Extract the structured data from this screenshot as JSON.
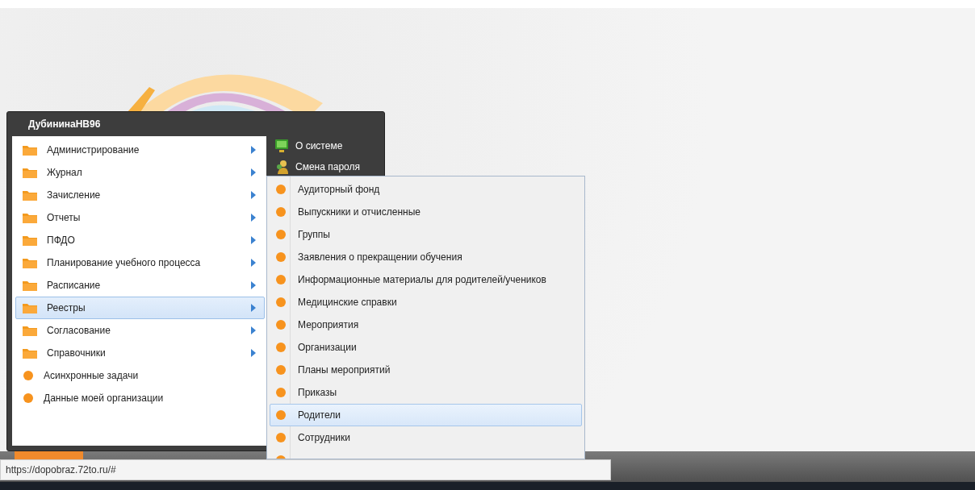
{
  "user": "ДубининаНВ96",
  "menu_items": [
    {
      "label": "Администрирование",
      "kind": "folder",
      "has_submenu": true,
      "selected": false
    },
    {
      "label": "Журнал",
      "kind": "folder",
      "has_submenu": true,
      "selected": false
    },
    {
      "label": "Зачисление",
      "kind": "folder",
      "has_submenu": true,
      "selected": false
    },
    {
      "label": "Отчеты",
      "kind": "folder",
      "has_submenu": true,
      "selected": false
    },
    {
      "label": "ПФДО",
      "kind": "folder",
      "has_submenu": true,
      "selected": false
    },
    {
      "label": "Планирование учебного процесса",
      "kind": "folder",
      "has_submenu": true,
      "selected": false
    },
    {
      "label": "Расписание",
      "kind": "folder",
      "has_submenu": true,
      "selected": false
    },
    {
      "label": "Реестры",
      "kind": "folder",
      "has_submenu": true,
      "selected": true
    },
    {
      "label": "Согласование",
      "kind": "folder",
      "has_submenu": true,
      "selected": false
    },
    {
      "label": "Справочники",
      "kind": "folder",
      "has_submenu": true,
      "selected": false
    },
    {
      "label": "Асинхронные задачи",
      "kind": "task",
      "has_submenu": false,
      "selected": false
    },
    {
      "label": "Данные моей организации",
      "kind": "task",
      "has_submenu": false,
      "selected": false
    }
  ],
  "side_links": [
    {
      "label": "О системе",
      "kind": "monitor"
    },
    {
      "label": "Смена пароля",
      "kind": "users"
    }
  ],
  "submenu_items": [
    {
      "label": "Аудиторный фонд",
      "selected": false
    },
    {
      "label": "Выпускники и отчисленные",
      "selected": false
    },
    {
      "label": "Группы",
      "selected": false
    },
    {
      "label": "Заявления о прекращении обучения",
      "selected": false
    },
    {
      "label": "Информационные материалы для родителей/учеников",
      "selected": false
    },
    {
      "label": "Медицинские справки",
      "selected": false
    },
    {
      "label": "Мероприятия",
      "selected": false
    },
    {
      "label": "Организации",
      "selected": false
    },
    {
      "label": "Планы мероприятий",
      "selected": false
    },
    {
      "label": "Приказы",
      "selected": false
    },
    {
      "label": "Родители",
      "selected": true
    },
    {
      "label": "Сотрудники",
      "selected": false
    }
  ],
  "status_url": "https://dopobraz.72to.ru/#"
}
